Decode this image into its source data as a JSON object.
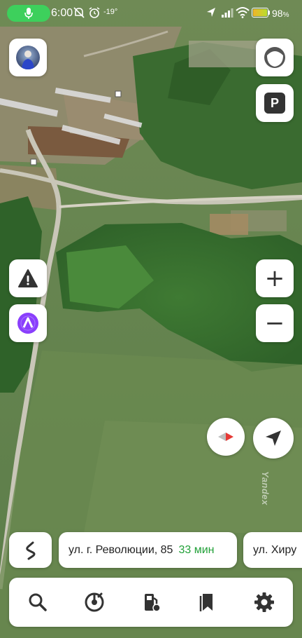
{
  "status_bar": {
    "time": "6:00",
    "temperature": "-19°",
    "battery_percent": "98",
    "battery_suffix": "%",
    "battery_level": 0.98,
    "icons": [
      "microphone-icon",
      "do-not-disturb-icon",
      "alarm-icon",
      "location-arrow-icon",
      "signal-icon",
      "wifi-icon",
      "battery-icon"
    ]
  },
  "map": {
    "provider_watermark": "Yandex",
    "pins": [
      "map-pin-icon",
      "map-pin-icon"
    ]
  },
  "controls": {
    "left": [
      "avatar",
      "road-alert-icon",
      "alice-assistant-icon"
    ],
    "right": [
      "layers-icon",
      "parking-icon",
      "zoom-in-icon",
      "zoom-out-icon",
      "compass-icon",
      "locate-me-icon"
    ],
    "parking_label": "P",
    "zoom_in_label": "+",
    "zoom_out_label": "−"
  },
  "routes": [
    {
      "destination": "ул. г. Революции, 85",
      "eta": "33 мин"
    },
    {
      "destination": "ул. Хиру",
      "eta": ""
    }
  ],
  "bottom_nav": {
    "items": [
      "search-icon",
      "music-icon",
      "fuel-icon",
      "bookmarks-icon",
      "settings-icon"
    ]
  },
  "colors": {
    "status_pill": "#3dd05c",
    "eta_green": "#21a038",
    "alice_purple": "#8a3ffc",
    "compass_red": "#e53935"
  }
}
